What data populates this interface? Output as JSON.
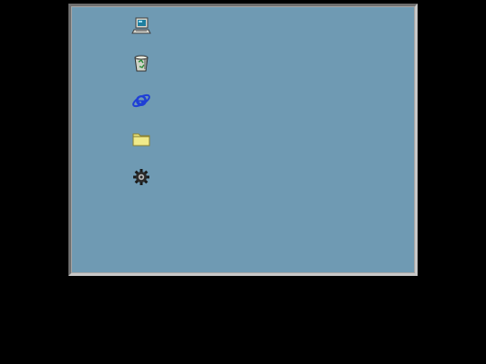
{
  "desktop": {
    "background_color": "#6f9ab3",
    "icons": [
      {
        "icon": "my-computer-icon"
      },
      {
        "icon": "recycle-bin-icon"
      },
      {
        "icon": "internet-explorer-icon"
      },
      {
        "icon": "folder-icon"
      },
      {
        "icon": "settings-gear-icon"
      }
    ]
  },
  "colors": {
    "outer_background": "#000000",
    "frame": "#a6a6a6",
    "folder_yellow": "#e6e07a",
    "ie_blue": "#1f3fd6"
  }
}
